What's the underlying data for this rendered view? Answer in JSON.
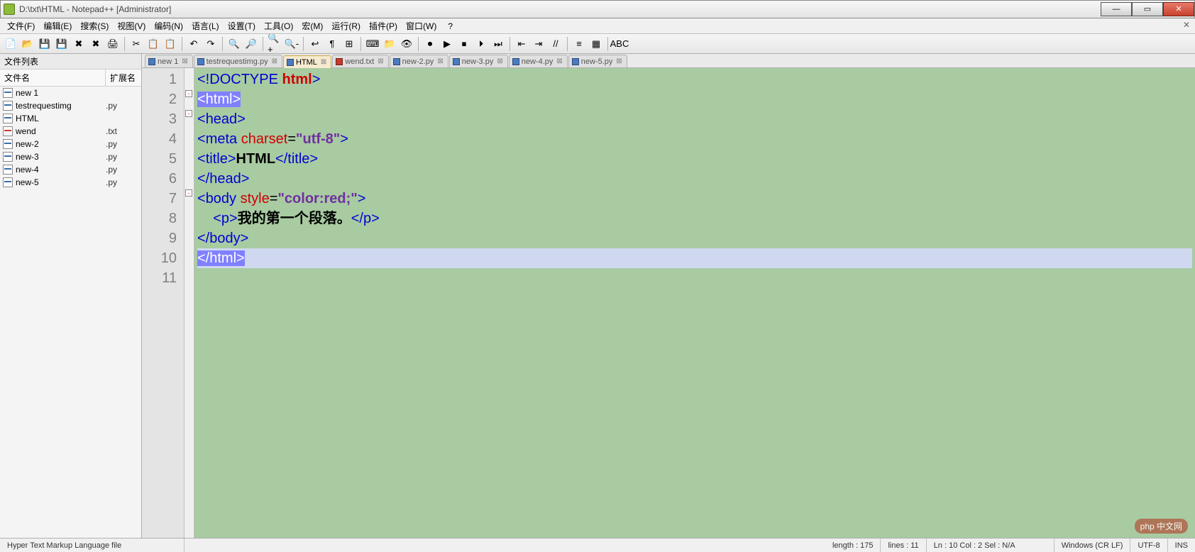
{
  "window": {
    "title": "D:\\txt\\HTML - Notepad++ [Administrator]"
  },
  "menu": {
    "items": [
      "文件(F)",
      "编辑(E)",
      "搜索(S)",
      "视图(V)",
      "编码(N)",
      "语言(L)",
      "设置(T)",
      "工具(O)",
      "宏(M)",
      "运行(R)",
      "插件(P)",
      "窗口(W)"
    ],
    "help": "?"
  },
  "toolbar_icons": [
    {
      "name": "new-file-icon",
      "glyph": "📄"
    },
    {
      "name": "open-file-icon",
      "glyph": "📂"
    },
    {
      "name": "save-icon",
      "glyph": "💾"
    },
    {
      "name": "save-all-icon",
      "glyph": "💾"
    },
    {
      "name": "close-icon",
      "glyph": "✖"
    },
    {
      "name": "close-all-icon",
      "glyph": "✖"
    },
    {
      "name": "print-icon",
      "glyph": "🖨"
    },
    {
      "sep": true
    },
    {
      "name": "cut-icon",
      "glyph": "✂"
    },
    {
      "name": "copy-icon",
      "glyph": "📋"
    },
    {
      "name": "paste-icon",
      "glyph": "📋"
    },
    {
      "sep": true
    },
    {
      "name": "undo-icon",
      "glyph": "↶"
    },
    {
      "name": "redo-icon",
      "glyph": "↷"
    },
    {
      "sep": true
    },
    {
      "name": "find-icon",
      "glyph": "🔍"
    },
    {
      "name": "replace-icon",
      "glyph": "🔎"
    },
    {
      "sep": true
    },
    {
      "name": "zoom-in-icon",
      "glyph": "🔍+"
    },
    {
      "name": "zoom-out-icon",
      "glyph": "🔍-"
    },
    {
      "sep": true
    },
    {
      "name": "wordwrap-icon",
      "glyph": "↩"
    },
    {
      "name": "allchars-icon",
      "glyph": "¶"
    },
    {
      "name": "indent-guide-icon",
      "glyph": "⊞"
    },
    {
      "sep": true
    },
    {
      "name": "lang-icon",
      "glyph": "⌨"
    },
    {
      "name": "folder-icon",
      "glyph": "📁"
    },
    {
      "name": "monitor-icon",
      "glyph": "👁"
    },
    {
      "sep": true
    },
    {
      "name": "record-icon",
      "glyph": "⏺"
    },
    {
      "name": "play-icon",
      "glyph": "▶"
    },
    {
      "name": "stop-icon",
      "glyph": "⏹"
    },
    {
      "name": "play2-icon",
      "glyph": "⏵"
    },
    {
      "name": "fast-icon",
      "glyph": "⏭"
    },
    {
      "sep": true
    },
    {
      "name": "indent-left-icon",
      "glyph": "⇤"
    },
    {
      "name": "indent-right-icon",
      "glyph": "⇥"
    },
    {
      "name": "comment-icon",
      "glyph": "//"
    },
    {
      "sep": true
    },
    {
      "name": "function-list-icon",
      "glyph": "≡"
    },
    {
      "name": "doc-map-icon",
      "glyph": "▦"
    },
    {
      "sep": true
    },
    {
      "name": "spellcheck-icon",
      "glyph": "ABC"
    }
  ],
  "sidebar": {
    "title": "文件列表",
    "col_name": "文件名",
    "col_ext": "扩展名",
    "files": [
      {
        "name": "new 1",
        "ext": "",
        "kind": "blue"
      },
      {
        "name": "testrequestimg",
        "ext": ".py",
        "kind": "blue"
      },
      {
        "name": "HTML",
        "ext": "",
        "kind": "blue"
      },
      {
        "name": "wend",
        "ext": ".txt",
        "kind": "red"
      },
      {
        "name": "new-2",
        "ext": ".py",
        "kind": "blue"
      },
      {
        "name": "new-3",
        "ext": ".py",
        "kind": "blue"
      },
      {
        "name": "new-4",
        "ext": ".py",
        "kind": "blue"
      },
      {
        "name": "new-5",
        "ext": ".py",
        "kind": "blue"
      }
    ]
  },
  "tabs": [
    {
      "label": "new 1",
      "kind": "blue"
    },
    {
      "label": "testrequestimg.py",
      "kind": "blue"
    },
    {
      "label": "HTML",
      "kind": "blue",
      "active": true
    },
    {
      "label": "wend.txt",
      "kind": "red"
    },
    {
      "label": "new-2.py",
      "kind": "blue"
    },
    {
      "label": "new-3.py",
      "kind": "blue"
    },
    {
      "label": "new-4.py",
      "kind": "blue"
    },
    {
      "label": "new-5.py",
      "kind": "blue"
    }
  ],
  "code": {
    "lines": [
      {
        "n": 1,
        "html": "<span class='hl-ang'>&lt;!</span><span class='hl-tag'>DOCTYPE</span> <span class='hl-attr bold'>html</span><span class='hl-ang'>&gt;</span>"
      },
      {
        "n": 2,
        "fold": true,
        "html": "<span class='hl-highlight'>&lt;html&gt;</span>",
        "hl": true
      },
      {
        "n": 3,
        "fold": true,
        "html": "<span class='hl-ang'>&lt;</span><span class='hl-tag'>head</span><span class='hl-ang'>&gt;</span>"
      },
      {
        "n": 4,
        "html": "<span class='hl-ang'>&lt;</span><span class='hl-tag'>meta</span> <span class='hl-attr'>charset</span>=<span class='hl-str'>\"utf-8\"</span><span class='hl-ang'>&gt;</span>"
      },
      {
        "n": 5,
        "html": "<span class='hl-ang'>&lt;</span><span class='hl-tag'>title</span><span class='hl-ang'>&gt;</span><span class='bold'>HTML</span><span class='hl-ang'>&lt;/</span><span class='hl-tag'>title</span><span class='hl-ang'>&gt;</span>"
      },
      {
        "n": 6,
        "html": "<span class='hl-ang'>&lt;/</span><span class='hl-tag'>head</span><span class='hl-ang'>&gt;</span>"
      },
      {
        "n": 7,
        "fold": true,
        "html": "<span class='hl-ang'>&lt;</span><span class='hl-tag'>body</span> <span class='hl-attr'>style</span>=<span class='hl-str'>\"color:red;\"</span><span class='hl-ang'>&gt;</span>"
      },
      {
        "n": 8,
        "html": "    <span class='hl-ang'>&lt;</span><span class='hl-tag'>p</span><span class='hl-ang'>&gt;</span><span class='bold'>我的第一个段落。</span><span class='hl-ang'>&lt;/</span><span class='hl-tag'>p</span><span class='hl-ang'>&gt;</span>"
      },
      {
        "n": 9,
        "html": "<span class='hl-ang'>&lt;/</span><span class='hl-tag'>body</span><span class='hl-ang'>&gt;</span>"
      },
      {
        "n": 10,
        "current": true,
        "html": "<span class='hl-highlight'>&lt;/html&gt;</span>"
      },
      {
        "n": 11,
        "html": ""
      }
    ]
  },
  "status": {
    "filetype": "Hyper Text Markup Language file",
    "length": "length : 175",
    "lines": "lines : 11",
    "pos": "Ln : 10    Col : 2    Sel : N/A",
    "eol": "Windows (CR LF)",
    "enc": "UTF-8",
    "ins": "INS"
  },
  "watermark": "php 中文网"
}
